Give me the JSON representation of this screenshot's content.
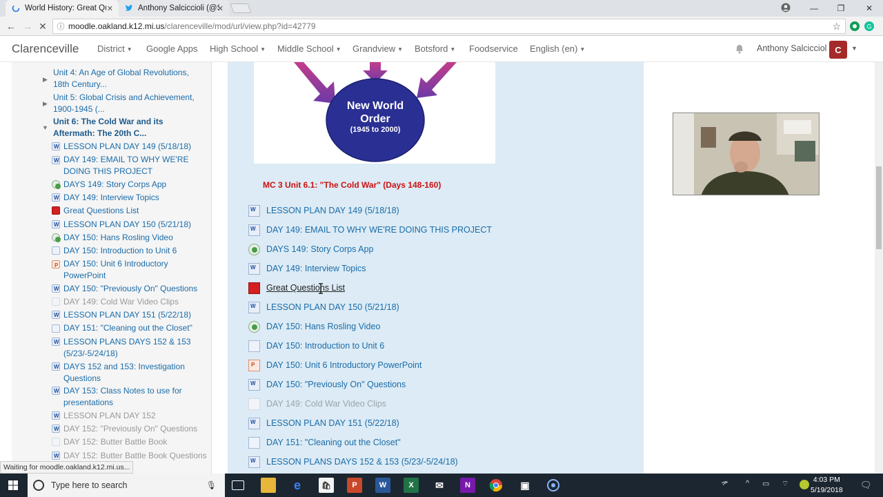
{
  "browser": {
    "tabs": [
      {
        "title": "World History: Great Que",
        "icon": "loading-icon"
      },
      {
        "title": "Anthony Salciccioli (@Sa",
        "icon": "twitter-icon"
      }
    ],
    "url_host": "moodle.oakland.k12.mi.us",
    "url_path": "/clarenceville/mod/url/view.php?id=42779",
    "status_text": "Waiting for moodle.oakland.k12.mi.us..."
  },
  "navbar": {
    "brand": "Clarenceville",
    "items": [
      "District",
      "Google Apps",
      "High School",
      "Middle School",
      "Grandview",
      "Botsford",
      "Foodservice",
      "English (en)"
    ],
    "user_name": "Anthony Salcicciol"
  },
  "drawer": {
    "sections": [
      {
        "label": "Unit 4: An Age of Global Revolutions, 18th Century..."
      },
      {
        "label": "Unit 5: Global Crisis and Achievement, 1900-1945 (..."
      },
      {
        "label": "Unit 6: The Cold War and its Aftermath: The 20th C..."
      }
    ],
    "activities": [
      {
        "label": "LESSON PLAN DAY 149 (5/18/18)",
        "icon": "word-icon"
      },
      {
        "label": "DAY 149: EMAIL TO WHY WE'RE DOING THIS PROJECT",
        "icon": "word-icon"
      },
      {
        "label": "DAYS 149: Story Corps App",
        "icon": "url-icon"
      },
      {
        "label": "DAY 149: Interview Topics",
        "icon": "word-icon"
      },
      {
        "label": "Great Questions List",
        "icon": "pdf-icon"
      },
      {
        "label": "LESSON PLAN DAY 150 (5/21/18)",
        "icon": "word-icon"
      },
      {
        "label": "DAY 150: Hans Rosling Video",
        "icon": "url-icon"
      },
      {
        "label": "DAY 150: Introduction to Unit 6",
        "icon": "page-icon"
      },
      {
        "label": "DAY 150: Unit 6 Introductory PowerPoint",
        "icon": "powerpoint-icon"
      },
      {
        "label": "DAY 150: \"Previously On\" Questions",
        "icon": "word-icon"
      },
      {
        "label": "DAY 149: Cold War Video Clips",
        "icon": "page-icon"
      },
      {
        "label": "LESSON PLAN DAY 151 (5/22/18)",
        "icon": "word-icon"
      },
      {
        "label": "DAY 151: \"Cleaning out the Closet\"",
        "icon": "page-icon"
      },
      {
        "label": "LESSON PLANS DAYS 152 & 153 (5/23/-5/24/18)",
        "icon": "word-icon"
      },
      {
        "label": "DAYS 152 and 153: Investigation Questions",
        "icon": "word-icon"
      },
      {
        "label": "DAY 153: Class Notes to use for presentations",
        "icon": "word-icon"
      },
      {
        "label": "LESSON PLAN DAY 152",
        "icon": "word-icon"
      },
      {
        "label": "DAY 152: \"Previously On\" Questions",
        "icon": "word-icon"
      },
      {
        "label": "DAY 152: Butter Battle Book",
        "icon": "page-icon"
      },
      {
        "label": "DAY 152: Butter Battle Book Questions",
        "icon": "word-icon"
      }
    ]
  },
  "diagram": {
    "line1": "New World",
    "line2": "Order",
    "line3": "(1945 to 2000)"
  },
  "main": {
    "topic_title": "MC 3 Unit 6.1: \"The Cold War\" (Days 148-160)",
    "items": [
      {
        "label": "LESSON PLAN DAY 149 (5/18/18)",
        "icon": "word-icon"
      },
      {
        "label": "DAY 149: EMAIL TO WHY WE'RE DOING THIS PROJECT",
        "icon": "word-icon"
      },
      {
        "label": "DAYS 149: Story Corps App",
        "icon": "url-icon"
      },
      {
        "label": "DAY 149: Interview Topics",
        "icon": "word-icon"
      },
      {
        "label": "Great Questions List",
        "icon": "pdf-icon"
      },
      {
        "label": "LESSON PLAN DAY 150 (5/21/18)",
        "icon": "word-icon"
      },
      {
        "label": "DAY 150: Hans Rosling Video",
        "icon": "url-icon"
      },
      {
        "label": "DAY 150: Introduction to Unit 6",
        "icon": "page-icon"
      },
      {
        "label": "DAY 150: Unit 6 Introductory PowerPoint",
        "icon": "powerpoint-icon"
      },
      {
        "label": "DAY 150: \"Previously On\" Questions",
        "icon": "word-icon"
      },
      {
        "label": "DAY 149: Cold War Video Clips",
        "icon": "page-icon"
      },
      {
        "label": "LESSON PLAN DAY 151 (5/22/18)",
        "icon": "word-icon"
      },
      {
        "label": "DAY 151: \"Cleaning out the Closet\"",
        "icon": "page-icon"
      },
      {
        "label": "LESSON PLANS DAYS 152 & 153 (5/23/-5/24/18)",
        "icon": "word-icon"
      }
    ]
  },
  "taskbar": {
    "search_placeholder": "Type here to search",
    "time": "4:03 PM",
    "date": "5/19/2018"
  },
  "colors": {
    "link": "#1b6ca8",
    "topic_title": "#cc1010",
    "main_bg": "#dcebf5",
    "diagram_circle": "#2a2f93",
    "arrow": "#b03c9c"
  }
}
